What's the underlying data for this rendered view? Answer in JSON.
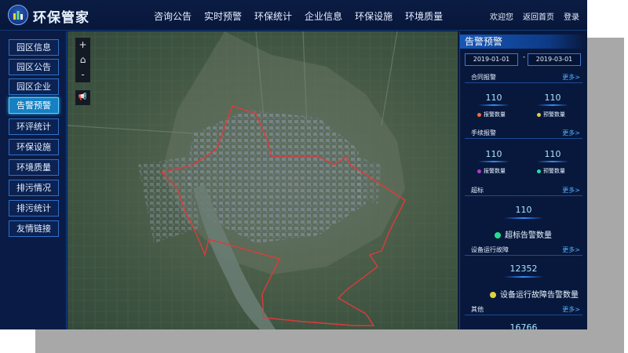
{
  "app": {
    "title": "环保管家",
    "nav": [
      "咨询公告",
      "实时预警",
      "环保统计",
      "企业信息",
      "环保设施",
      "环境质量"
    ],
    "header_links": [
      "欢迎您",
      "返回首页",
      "登录"
    ]
  },
  "sidebar": {
    "items": [
      "园区信息",
      "园区公告",
      "园区企业",
      "告警预警",
      "环评统计",
      "环保设施",
      "环境质量",
      "排污情况",
      "排污统计",
      "友情链接"
    ],
    "active_index": 3
  },
  "map_tools": [
    "+",
    "⌂",
    "-",
    "📢"
  ],
  "panel": {
    "title": "告警预警",
    "date_start": "2019-01-01",
    "date_sep": "-",
    "date_end": "2019-03-01",
    "more": "更多>",
    "sections": {
      "contract": {
        "title": "合同报警",
        "v1": "110",
        "v2": "110",
        "l1": "报警数量",
        "l2": "预警数量",
        "c1": "#ff6a2b",
        "c2": "#e6cc3c"
      },
      "procedure": {
        "title": "手续报警",
        "v1": "110",
        "v2": "110",
        "l1": "报警数量",
        "l2": "预警数量",
        "c1": "#b03ad8",
        "c2": "#1fe0a6"
      },
      "exceed": {
        "title": "超标",
        "value": "110",
        "label": "超标告警数量",
        "color": "#21e08a"
      },
      "fault": {
        "title": "设备运行故障",
        "value": "12352",
        "label": "设备运行故障告警数量",
        "color": "#e0d23c"
      },
      "other": {
        "title": "其他",
        "value": "16766"
      }
    }
  }
}
